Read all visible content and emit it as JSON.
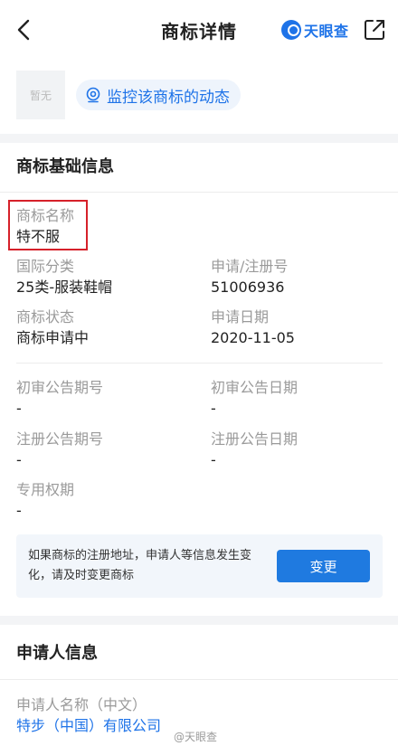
{
  "topbar": {
    "title": "商标详情",
    "brand": "天眼查"
  },
  "header": {
    "logo_placeholder": "暂无",
    "monitor_label": "监控该商标的动态"
  },
  "basic_info": {
    "section_title": "商标基础信息",
    "trademark_name": {
      "label": "商标名称",
      "value": "特不服"
    },
    "intl_class": {
      "label": "国际分类",
      "value": "25类-服装鞋帽"
    },
    "reg_no": {
      "label": "申请/注册号",
      "value": "51006936"
    },
    "status": {
      "label": "商标状态",
      "value": "商标申请中"
    },
    "apply_date": {
      "label": "申请日期",
      "value": "2020-11-05"
    },
    "prelim_pub_no": {
      "label": "初审公告期号",
      "value": "-"
    },
    "prelim_pub_date": {
      "label": "初审公告日期",
      "value": "-"
    },
    "reg_pub_no": {
      "label": "注册公告期号",
      "value": "-"
    },
    "reg_pub_date": {
      "label": "注册公告日期",
      "value": "-"
    },
    "exclusive_period": {
      "label": "专用权期",
      "value": "-"
    }
  },
  "notice": {
    "text": "如果商标的注册地址，申请人等信息发生变化，请及时变更商标",
    "button": "变更"
  },
  "applicant": {
    "section_title": "申请人信息",
    "name_cn": {
      "label": "申请人名称（中文）",
      "value": "特步（中国）有限公司"
    }
  },
  "watermark": "@天眼查",
  "colors": {
    "accent": "#1e73e8",
    "highlight": "#d6212a",
    "muted": "#9a9a9a"
  }
}
